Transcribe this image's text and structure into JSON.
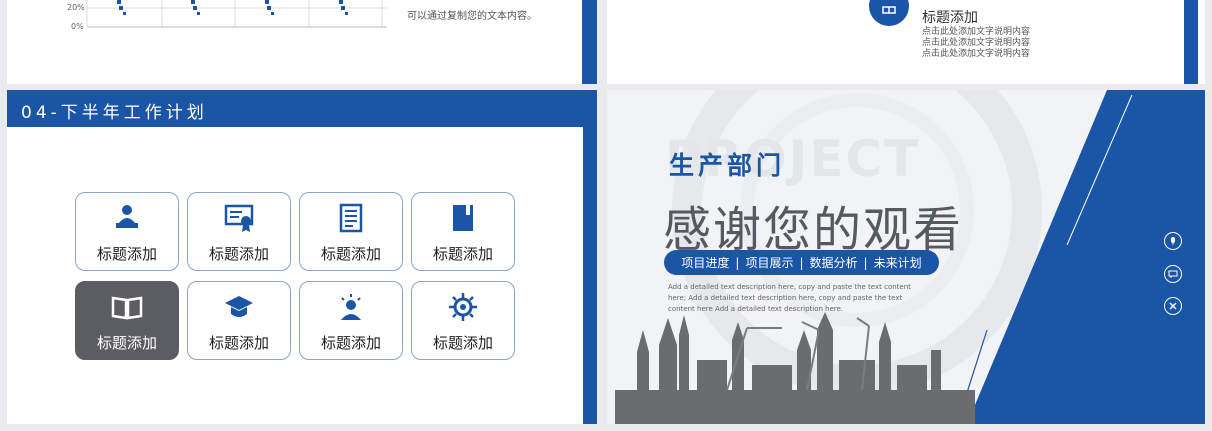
{
  "top_left": {
    "axis_labels": [
      "20%",
      "0%"
    ],
    "note": "可以通过复制您的文本内容。"
  },
  "top_right": {
    "icon": "book-icon",
    "title": "标题添加",
    "lines": [
      "点击此处添加文字说明内容",
      "点击此处添加文字说明内容",
      "点击此处添加文字说明内容"
    ]
  },
  "bottom_left": {
    "header": "04-下半年工作计划",
    "cards": [
      {
        "label": "标题添加",
        "icon": "person-laptop-icon"
      },
      {
        "label": "标题添加",
        "icon": "certificate-icon"
      },
      {
        "label": "标题添加",
        "icon": "document-list-icon"
      },
      {
        "label": "标题添加",
        "icon": "notebook-icon"
      },
      {
        "label": "标题添加",
        "icon": "open-book-icon",
        "active": true
      },
      {
        "label": "标题添加",
        "icon": "graduation-cap-icon"
      },
      {
        "label": "标题添加",
        "icon": "idea-person-icon"
      },
      {
        "label": "标题添加",
        "icon": "virus-gear-icon"
      }
    ],
    "colors": {
      "accent": "#1a55a6",
      "active_card": "#5c5d62"
    }
  },
  "bottom_right": {
    "bg_word": "PROJECT",
    "department": "生产部门",
    "title": "感谢您的观看",
    "nav": [
      "项目进度",
      "项目展示",
      "数据分析",
      "未来计划"
    ],
    "description": "Add a detailed text description here, copy and paste the text content here; Add a detailed text description here, copy and paste the text content here Add a detailed text description here.",
    "side_icons": [
      "microphone-icon",
      "chat-icon",
      "tools-icon"
    ]
  }
}
